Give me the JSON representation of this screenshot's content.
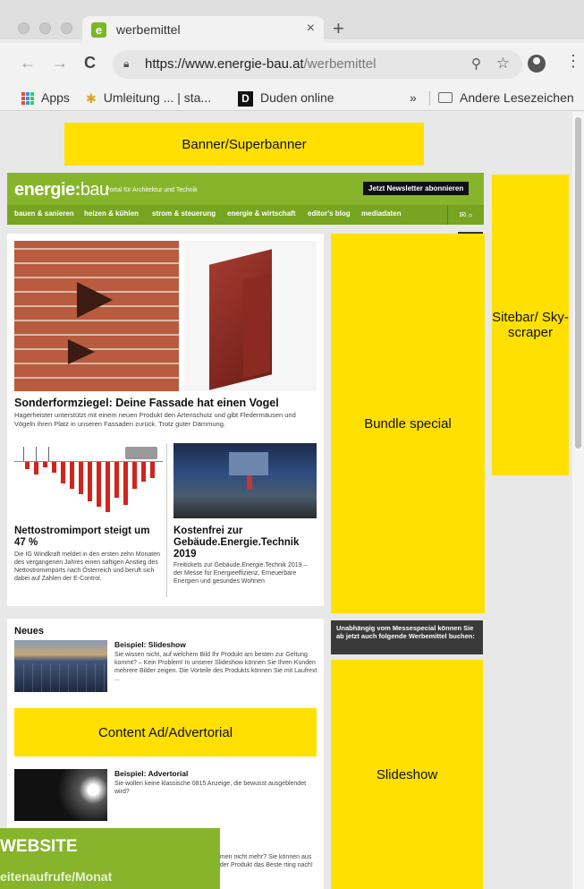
{
  "browser": {
    "tab_title": "werbemittel",
    "tab_favicon_letter": "e",
    "tab_close": "×",
    "new_tab": "+",
    "url_host": "https://www.energie-bau.at",
    "url_path": "/werbemittel",
    "bookmarks": {
      "apps": "Apps",
      "umleitung": "Umleitung ... | sta...",
      "duden": "Duden online",
      "duden_icon_letter": "D",
      "overflow": "»",
      "andere": "Andere Lesezeichen"
    }
  },
  "ad_slots": {
    "banner": "Banner/Superbanner",
    "sitebar": "Sitebar/ Sky- scraper",
    "bundle": "Bundle special",
    "content_ad": "Content Ad/Advertorial",
    "slideshow": "Slideshow"
  },
  "site": {
    "logo_bold": "energie:",
    "logo_thin": "bau",
    "tagline": "Portal für Architektur und Technik",
    "newsletter_button": "Jetzt Newsletter abonnieren",
    "nav": [
      "bauen & sanieren",
      "heizen & kühlen",
      "strom & steuerung",
      "energie & wirtschaft",
      "editor's blog",
      "mediadaten"
    ],
    "nav_icons": "✉ ⌕"
  },
  "articles": {
    "main_title": "Sonderformziegel: Deine Fassade hat einen Vogel",
    "main_desc": "Hagerheister unterstützt mit einem neuen Produkt den Artenschutz und gibt Fledermäusen und Vögeln ihren Platz in unseren Fassaden zurück. Trotz guter Dämmung.",
    "a2_title": "Nettostromimport steigt um 47 %",
    "a2_desc": "Die IG Windkraft meldet in den ersten zehn Monaten des vergangenen Jahres einen saftigen Anstieg des Nettostromimports nach Österreich und beruft sich dabei auf Zahlen der E-Control.",
    "a3_title": "Kostenfrei zur Gebäude.Energie.Technik 2019",
    "a3_desc": "Freitickets zur Gebäude.Energie.Technik 2019 – der Messe für Energieeffizienz, Erneuerbare Energien und gesundes Wohnen"
  },
  "neues": {
    "title": "Neues",
    "ex1_title": "Beispiel: Slideshow",
    "ex1_desc": "Sie wissen nicht, auf welchem Bild Ihr Produkt am besten zur Geltung kommt? – Kein Problem! In unserer Slideshow können Sie Ihren Kunden mehrere Bilder zeigen. Die Vorteile des Produkts können Sie mit Laufrext ...",
    "ex2_title": "Beispiel: Advertorial",
    "ex2_desc": "Sie wollen keine klassische 0815 Anzeige, die bewusst ausgeblendet wird?",
    "ex3_desc": "umen nicht mehr? Sie können aus oder Produkt das Beste rting nach!"
  },
  "sidebar_note": "Unabhängig vom Messespecial können Sie ab jetzt auch folgende Werbemittel buchen:",
  "green_box": {
    "title": "WEBSITE",
    "subtitle": "eitenaufrufe/Monat"
  },
  "colors": {
    "brand_green": "#86b52b",
    "ad_yellow": "#ffe000"
  }
}
